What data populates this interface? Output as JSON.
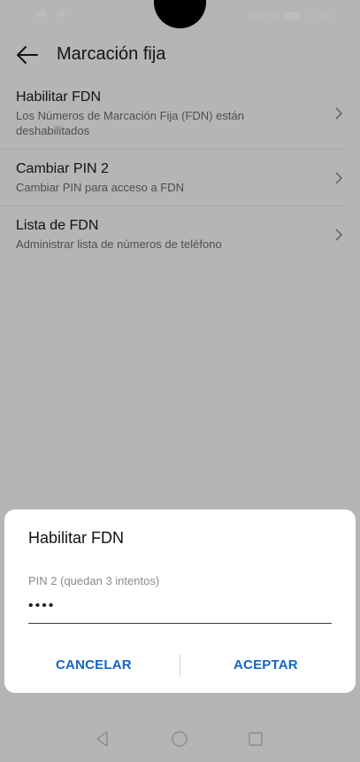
{
  "status_bar": {
    "battery_text": "100 %",
    "time": "10:00"
  },
  "toolbar": {
    "title": "Marcación fija"
  },
  "settings_list": [
    {
      "title": "Habilitar FDN",
      "subtitle": "Los Números de Marcación Fija (FDN) están deshabilitados"
    },
    {
      "title": "Cambiar PIN 2",
      "subtitle": "Cambiar PIN para acceso a FDN"
    },
    {
      "title": "Lista de FDN",
      "subtitle": "Administrar lista de números de teléfono"
    }
  ],
  "dialog": {
    "title": "Habilitar FDN",
    "field_label": "PIN 2 (quedan 3 intentos)",
    "field_value": "••••",
    "cancel_label": "CANCELAR",
    "accept_label": "ACEPTAR"
  },
  "colors": {
    "accent": "#1565c0"
  }
}
